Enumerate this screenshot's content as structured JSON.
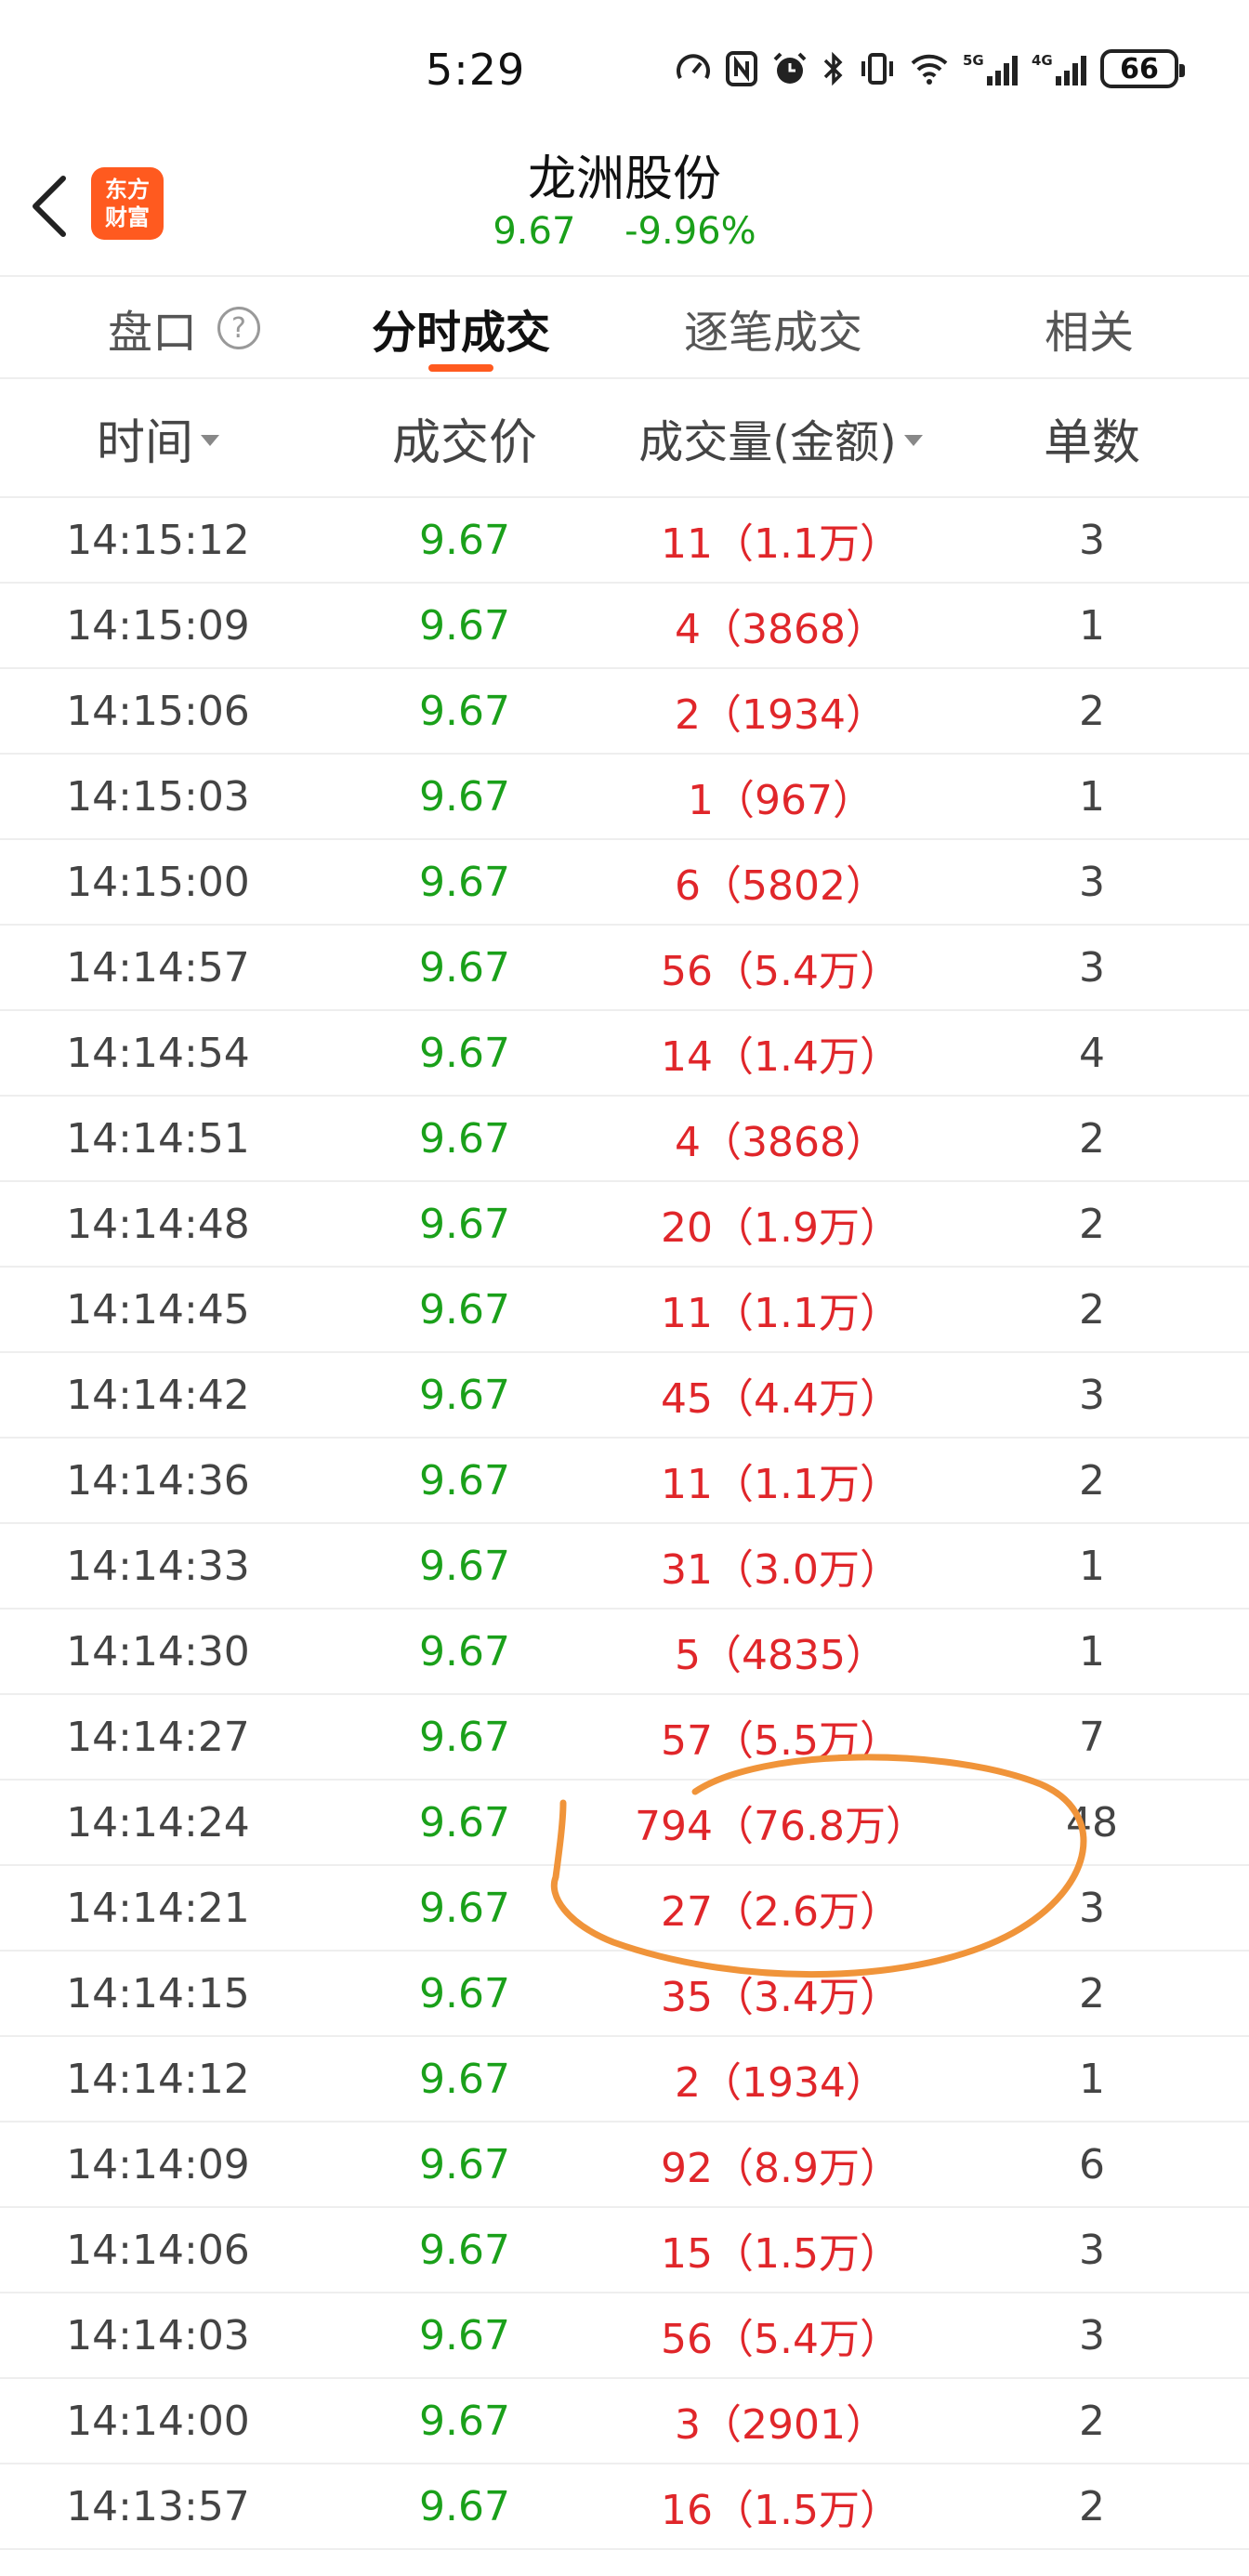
{
  "status": {
    "time": "5:29",
    "battery": "66",
    "net5g": "5G",
    "net4g": "4G"
  },
  "header": {
    "stock_name": "龙洲股份",
    "price": "9.67",
    "change_pct": "-9.96%",
    "logo_line1": "东方",
    "logo_line2": "财富"
  },
  "tabs": [
    {
      "label": "盘口"
    },
    {
      "label": "分时成交"
    },
    {
      "label": "逐笔成交"
    },
    {
      "label": "相关"
    }
  ],
  "columns": {
    "time": "时间",
    "price": "成交价",
    "volume": "成交量(金额)",
    "count": "单数"
  },
  "rows": [
    {
      "time": "14:15:12",
      "price": "9.67",
      "volume": "11（1.1万）",
      "count": "3"
    },
    {
      "time": "14:15:09",
      "price": "9.67",
      "volume": "4（3868）",
      "count": "1"
    },
    {
      "time": "14:15:06",
      "price": "9.67",
      "volume": "2（1934）",
      "count": "2"
    },
    {
      "time": "14:15:03",
      "price": "9.67",
      "volume": "1（967）",
      "count": "1"
    },
    {
      "time": "14:15:00",
      "price": "9.67",
      "volume": "6（5802）",
      "count": "3"
    },
    {
      "time": "14:14:57",
      "price": "9.67",
      "volume": "56（5.4万）",
      "count": "3"
    },
    {
      "time": "14:14:54",
      "price": "9.67",
      "volume": "14（1.4万）",
      "count": "4"
    },
    {
      "time": "14:14:51",
      "price": "9.67",
      "volume": "4（3868）",
      "count": "2"
    },
    {
      "time": "14:14:48",
      "price": "9.67",
      "volume": "20（1.9万）",
      "count": "2"
    },
    {
      "time": "14:14:45",
      "price": "9.67",
      "volume": "11（1.1万）",
      "count": "2"
    },
    {
      "time": "14:14:42",
      "price": "9.67",
      "volume": "45（4.4万）",
      "count": "3"
    },
    {
      "time": "14:14:36",
      "price": "9.67",
      "volume": "11（1.1万）",
      "count": "2"
    },
    {
      "time": "14:14:33",
      "price": "9.67",
      "volume": "31（3.0万）",
      "count": "1"
    },
    {
      "time": "14:14:30",
      "price": "9.67",
      "volume": "5（4835）",
      "count": "1"
    },
    {
      "time": "14:14:27",
      "price": "9.67",
      "volume": "57（5.5万）",
      "count": "7"
    },
    {
      "time": "14:14:24",
      "price": "9.67",
      "volume": "794（76.8万）",
      "count": "48"
    },
    {
      "time": "14:14:21",
      "price": "9.67",
      "volume": "27（2.6万）",
      "count": "3"
    },
    {
      "time": "14:14:15",
      "price": "9.67",
      "volume": "35（3.4万）",
      "count": "2"
    },
    {
      "time": "14:14:12",
      "price": "9.67",
      "volume": "2（1934）",
      "count": "1"
    },
    {
      "time": "14:14:09",
      "price": "9.67",
      "volume": "92（8.9万）",
      "count": "6"
    },
    {
      "time": "14:14:06",
      "price": "9.67",
      "volume": "15（1.5万）",
      "count": "3"
    },
    {
      "time": "14:14:03",
      "price": "9.67",
      "volume": "56（5.4万）",
      "count": "3"
    },
    {
      "time": "14:14:00",
      "price": "9.67",
      "volume": "3（2901）",
      "count": "2"
    },
    {
      "time": "14:13:57",
      "price": "9.67",
      "volume": "16（1.5万）",
      "count": "2"
    }
  ],
  "colors": {
    "up": "#e0262a",
    "down": "#1aa01a",
    "accent": "#ff5a1f",
    "annotation": "#f0943a"
  },
  "icons": {
    "back": "chevron-left-icon",
    "help": "help-icon",
    "status": [
      "speed-icon",
      "nfc-icon",
      "alarm-icon",
      "bluetooth-icon",
      "vibrate-icon",
      "wifi-icon",
      "signal-icon"
    ]
  }
}
